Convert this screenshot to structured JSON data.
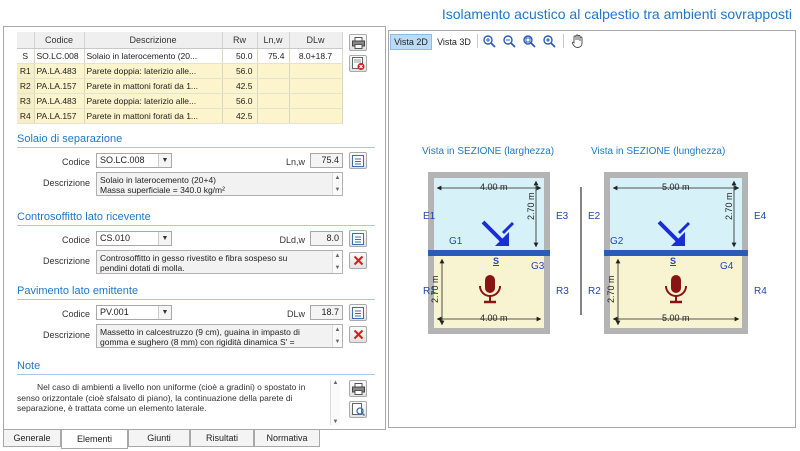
{
  "title": "Isolamento acustico al calpestio tra ambienti sovrapposti",
  "table": {
    "headers": [
      "",
      "Codice",
      "Descrizione",
      "Rw",
      "Ln,w",
      "DLw"
    ],
    "rows": [
      {
        "key": "S",
        "code": "SO.LC.008",
        "desc": "Solaio  in laterocemento (20...",
        "rw": "50.0",
        "lnw": "75.4",
        "dlw": "8.0+18.7"
      },
      {
        "key": "R1",
        "code": "PA.LA.483",
        "desc": "Parete doppia: laterizio alle...",
        "rw": "56.0",
        "lnw": "",
        "dlw": ""
      },
      {
        "key": "R2",
        "code": "PA.LA.157",
        "desc": "Parete in mattoni forati da 1...",
        "rw": "42.5",
        "lnw": "",
        "dlw": ""
      },
      {
        "key": "R3",
        "code": "PA.LA.483",
        "desc": "Parete doppia: laterizio alle...",
        "rw": "56.0",
        "lnw": "",
        "dlw": ""
      },
      {
        "key": "R4",
        "code": "PA.LA.157",
        "desc": "Parete in mattoni forati da 1...",
        "rw": "42.5",
        "lnw": "",
        "dlw": ""
      }
    ]
  },
  "labels": {
    "codice": "Codice",
    "descrizione": "Descrizione"
  },
  "solaio": {
    "title": "Solaio di separazione",
    "code": "SO.LC.008",
    "value_label": "Ln,w",
    "value": "75.4",
    "desc_line1": "Solaio  in laterocemento (20+4)",
    "desc_line2": "Massa superficiale = 340.0 kg/m²"
  },
  "controsoffitto": {
    "title": "Controsoffitto lato ricevente",
    "code": "CS.010",
    "value_label": "DLd,w",
    "value": "8.0",
    "desc_line1": "Controsoffitto in gesso rivestito e fibra sospeso su",
    "desc_line2": "pendini dotati di molla."
  },
  "pavimento": {
    "title": "Pavimento lato emittente",
    "code": "PV.001",
    "value_label": "DLw",
    "value": "18.7",
    "desc_line1": "Massetto in calcestruzzo (9 cm), guaina in impasto di",
    "desc_line2": "gomma e sughero (8 mm) con rigidità dinamica  S' ="
  },
  "note": {
    "title": "Note",
    "text": "Nel caso di ambienti a livello non uniforme (cioè a gradini) o spostato in senso orizzontale (cioè sfalsato di piano), la continuazione della parete di separazione, è trattata come un elemento laterale."
  },
  "tabs": [
    "Generale",
    "Elementi",
    "Giunti",
    "Risultati",
    "Normativa"
  ],
  "view_tabs": [
    "Vista 2D",
    "Vista 3D"
  ],
  "icons": [
    "print-icon",
    "delete-icon",
    "zoom-in-icon",
    "zoom-out-icon",
    "zoom-fit-icon",
    "zoom-window-icon",
    "pan-hand-icon",
    "print-preview-icon"
  ],
  "colors": {
    "accent": "#1f78c8",
    "upper_room": "#d6f2f8",
    "lower_room": "#f8f4d2",
    "slab": "#2a5bb8",
    "wall": "#b4b4b4",
    "arrow": "#1a2fd0",
    "source": "#8a1414"
  },
  "sections": [
    {
      "label": "Vista in SEZIONE (larghezza)",
      "width_top": "4.00 m",
      "width_bottom": "4.00 m",
      "height_top": "2.70 m",
      "height_bottom": "2.70 m",
      "e_left": "E1",
      "e_right": "E3",
      "g_left": "G1",
      "g_right": "G3",
      "r_left": "R1",
      "r_right": "R3",
      "s_label": "S"
    },
    {
      "label": "Vista in SEZIONE (lunghezza)",
      "width_top": "5.00 m",
      "width_bottom": "5.00 m",
      "height_top": "2.70 m",
      "height_bottom": "2.70 m",
      "e_left": "E2",
      "e_right": "E4",
      "g_left": "G2",
      "g_right": "G4",
      "r_left": "R2",
      "r_right": "R4",
      "s_label": "S"
    }
  ]
}
